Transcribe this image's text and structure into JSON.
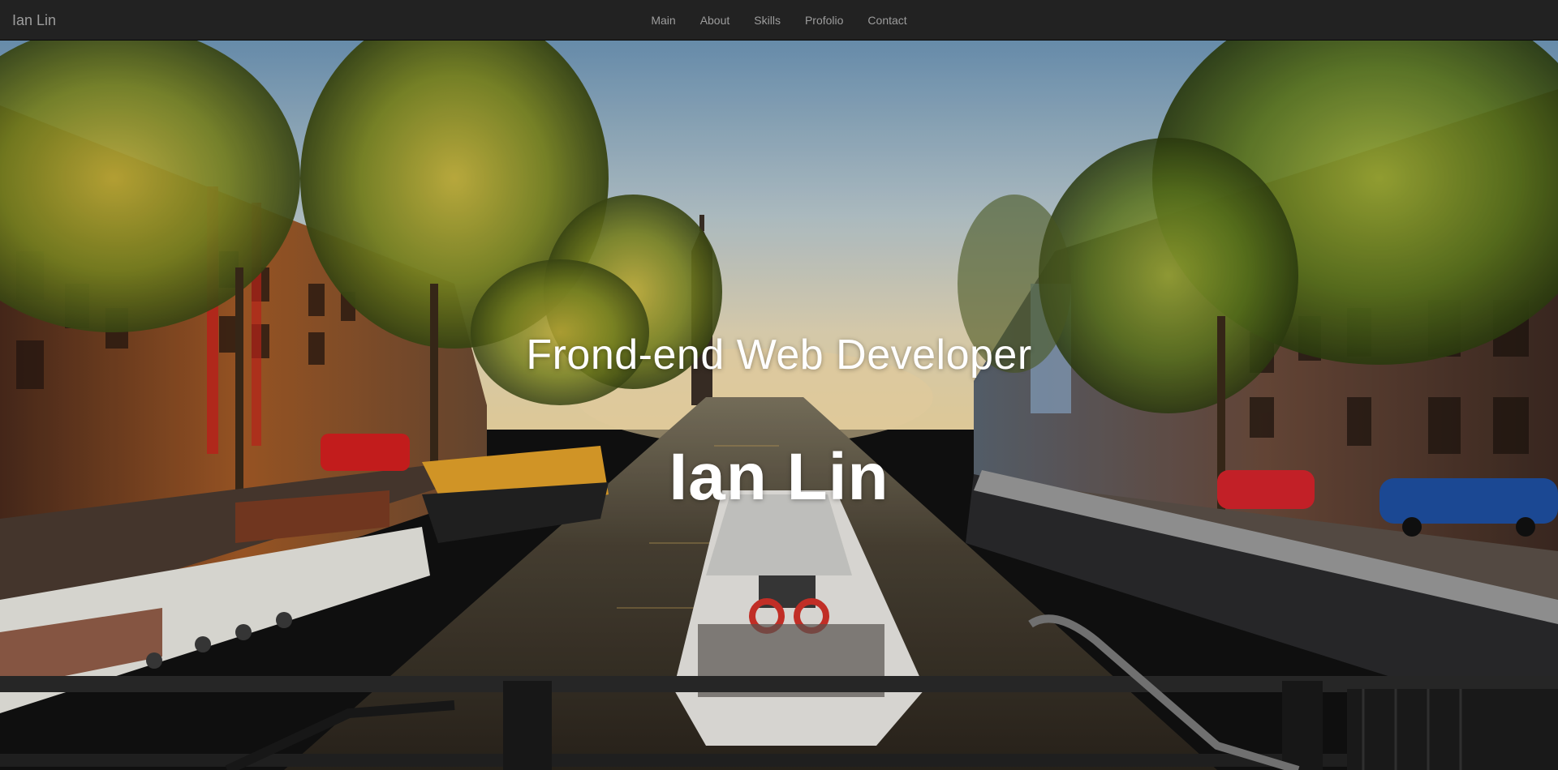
{
  "navbar": {
    "brand": "Ian Lin",
    "items": [
      {
        "label": "Main"
      },
      {
        "label": "About"
      },
      {
        "label": "Skills"
      },
      {
        "label": "Profolio"
      },
      {
        "label": "Contact"
      }
    ],
    "background": "#222222",
    "text_color": "#9d9d9d"
  },
  "hero": {
    "subtitle": "Frond-end Web Developer",
    "title": "Ian Lin",
    "text_color": "#ffffff",
    "background_image": "amsterdam-canal-photo"
  }
}
